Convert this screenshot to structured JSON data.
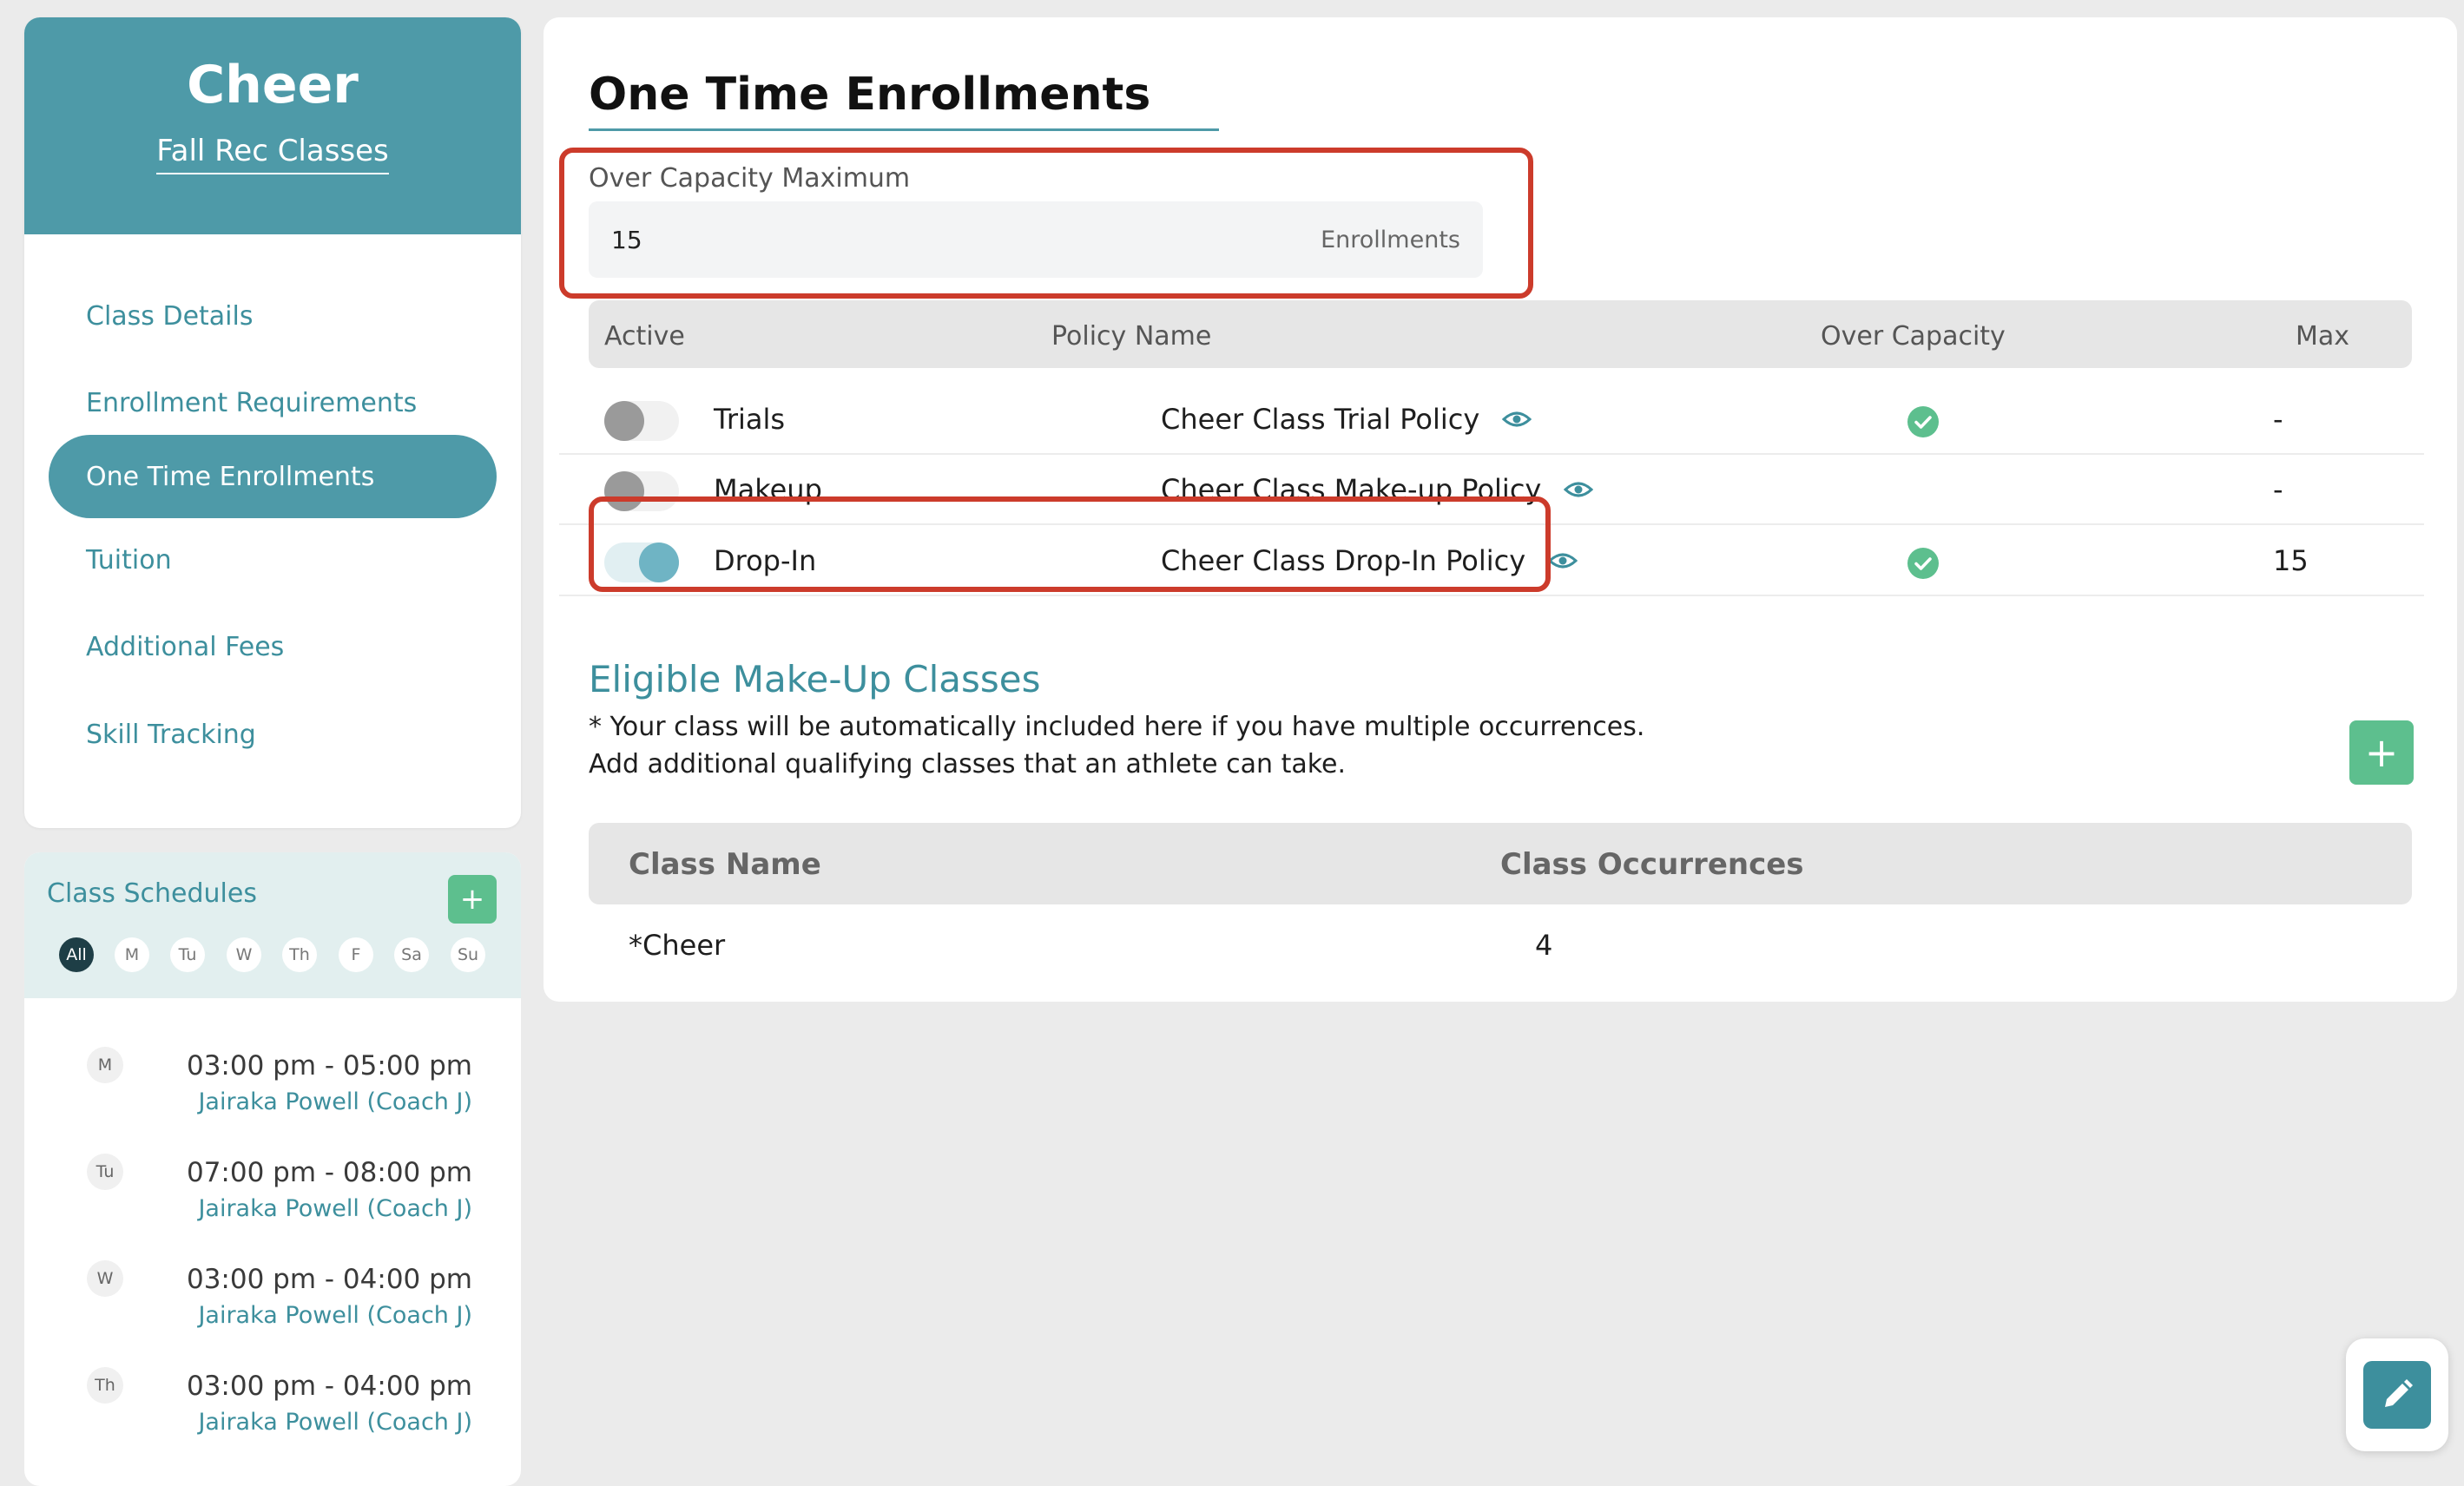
{
  "nav": {
    "title": "Cheer",
    "subtitle": "Fall Rec Classes",
    "items": [
      {
        "label": "Class Details"
      },
      {
        "label": "Enrollment Requirements"
      },
      {
        "label": "One Time Enrollments",
        "active": true
      },
      {
        "label": "Tuition"
      },
      {
        "label": "Additional Fees"
      },
      {
        "label": "Skill Tracking"
      }
    ]
  },
  "schedules": {
    "title": "Class Schedules",
    "add_label": "+",
    "days": [
      "All",
      "M",
      "Tu",
      "W",
      "Th",
      "F",
      "Sa",
      "Su"
    ],
    "active_day": "All",
    "entries": [
      {
        "day": "M",
        "time": "03:00 pm - 05:00 pm",
        "coach": "Jairaka Powell (Coach J)"
      },
      {
        "day": "Tu",
        "time": "07:00 pm - 08:00 pm",
        "coach": "Jairaka Powell (Coach J)"
      },
      {
        "day": "W",
        "time": "03:00 pm - 04:00 pm",
        "coach": "Jairaka Powell (Coach J)"
      },
      {
        "day": "Th",
        "time": "03:00 pm - 04:00 pm",
        "coach": "Jairaka Powell (Coach J)"
      }
    ]
  },
  "main": {
    "title": "One Time Enrollments",
    "over_capacity": {
      "label": "Over Capacity Maximum",
      "value": "15",
      "unit": "Enrollments"
    },
    "policies": {
      "headers": [
        "Active",
        "Policy Name",
        "Over Capacity",
        "Max"
      ],
      "rows": [
        {
          "type": "Trials",
          "active": false,
          "policy": "Cheer Class Trial Policy",
          "over_capacity": true,
          "max": "-"
        },
        {
          "type": "Makeup",
          "active": false,
          "policy": "Cheer Class Make-up Policy",
          "over_capacity": false,
          "max": "-"
        },
        {
          "type": "Drop-In",
          "active": true,
          "policy": "Cheer Class Drop-In Policy",
          "over_capacity": true,
          "max": "15"
        }
      ]
    },
    "makeup": {
      "title": "Eligible Make-Up Classes",
      "note_1": "* Your class will be automatically included here if you have multiple occurrences.",
      "note_2": "Add additional qualifying classes that an athlete can take.",
      "add_label": "+",
      "headers": [
        "Class Name",
        "Class Occurrences"
      ],
      "rows": [
        {
          "name": "*Cheer",
          "occurrences": "4"
        }
      ]
    }
  },
  "colors": {
    "brand": "#4e9aa8",
    "brand_text": "#3d8f9d",
    "success": "#5dbf8e",
    "highlight": "#cc3b2b"
  },
  "icons": {
    "view_policy": "eye-icon",
    "over_capacity": "check-circle-icon",
    "edit": "pencil-icon"
  }
}
